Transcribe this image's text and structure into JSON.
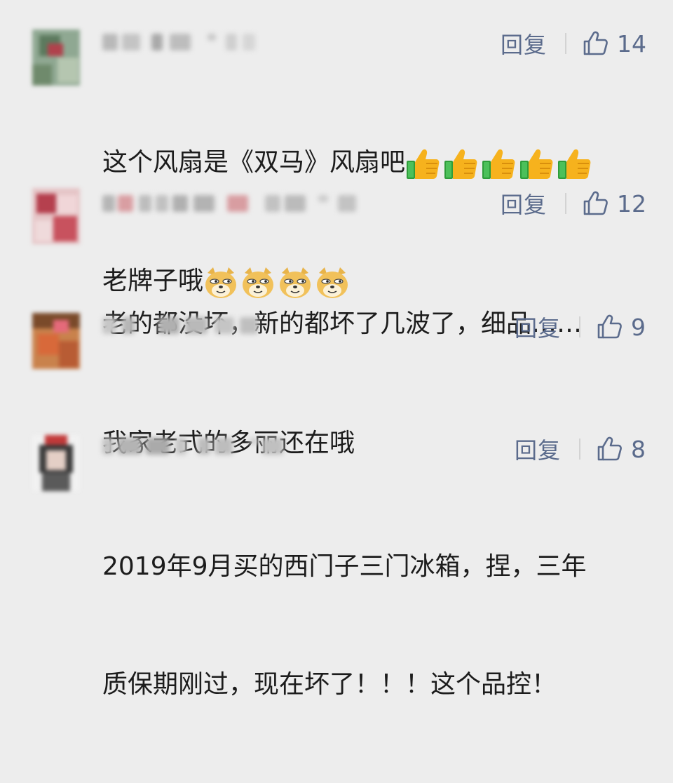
{
  "comments": [
    {
      "text_lines": [
        "这个风扇是《双马》风扇吧",
        "老牌子哦"
      ],
      "line1_emoji": "thumbs-up",
      "line1_emoji_count": 5,
      "line2_emoji": "doge",
      "line2_emoji_count": 4,
      "reply_label": "回复",
      "like_count": "14"
    },
    {
      "text_lines": [
        "老的都没坏，新的都坏了几波了，细品……"
      ],
      "reply_label": "回复",
      "like_count": "12"
    },
    {
      "text_lines": [
        "我家老式的多丽还在哦"
      ],
      "reply_label": "回复",
      "like_count": "9"
    },
    {
      "text_lines": [
        "2019年9月买的西门子三门冰箱，捏，三年",
        "质保期刚过，现在坏了！！！这个品控！"
      ],
      "reply_label": "回复",
      "like_count": "8"
    }
  ],
  "colors": {
    "background": "#ededed",
    "action": "#5b6b8c",
    "text": "#1c1c1c"
  },
  "icons": {
    "like": "thumbs-up-outline-icon"
  }
}
